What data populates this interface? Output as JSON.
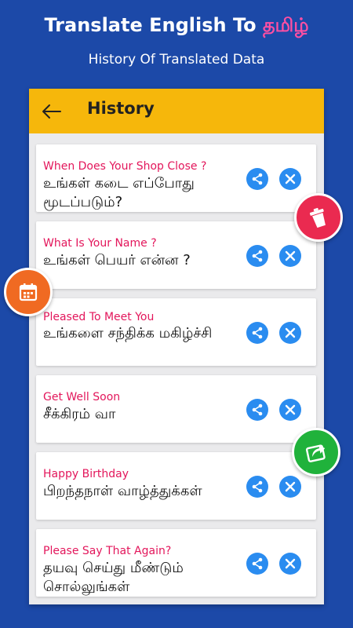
{
  "promo": {
    "title_prefix": "Translate English To ",
    "title_accent": "தமிழ்",
    "subtitle": "History Of Translated Data"
  },
  "appbar": {
    "title": "History",
    "back_icon": "arrow-left-icon"
  },
  "colors": {
    "background": "#1c49a8",
    "appbar": "#f6b70b",
    "english_text": "#e3165b",
    "action_button": "#2a8cf0",
    "trash_button": "#ea2a50",
    "calendar_button": "#f06a22",
    "share_float_button": "#20b23b"
  },
  "items": [
    {
      "english": "When Does Your Shop Close ?",
      "tamil": "உங்கள் கடை எப்போது மூடப்படும்?"
    },
    {
      "english": "What Is Your Name ?",
      "tamil": "உங்கள் பெயர் என்ன ?"
    },
    {
      "english": "Pleased To Meet You",
      "tamil": "உங்களை சந்திக்க மகிழ்ச்சி"
    },
    {
      "english": "Get Well Soon",
      "tamil": "சீக்கிரம் வா"
    },
    {
      "english": "Happy Birthday",
      "tamil": "பிறந்தநாள் வாழ்த்துக்கள்"
    },
    {
      "english": "Please Say That Again?",
      "tamil": "தயவு செய்து மீண்டும் சொல்லுங்கள்"
    }
  ],
  "icons": {
    "share": "share-icon",
    "delete": "close-icon",
    "trash": "trash-icon",
    "calendar": "calendar-icon",
    "export": "share-arrow-icon"
  }
}
